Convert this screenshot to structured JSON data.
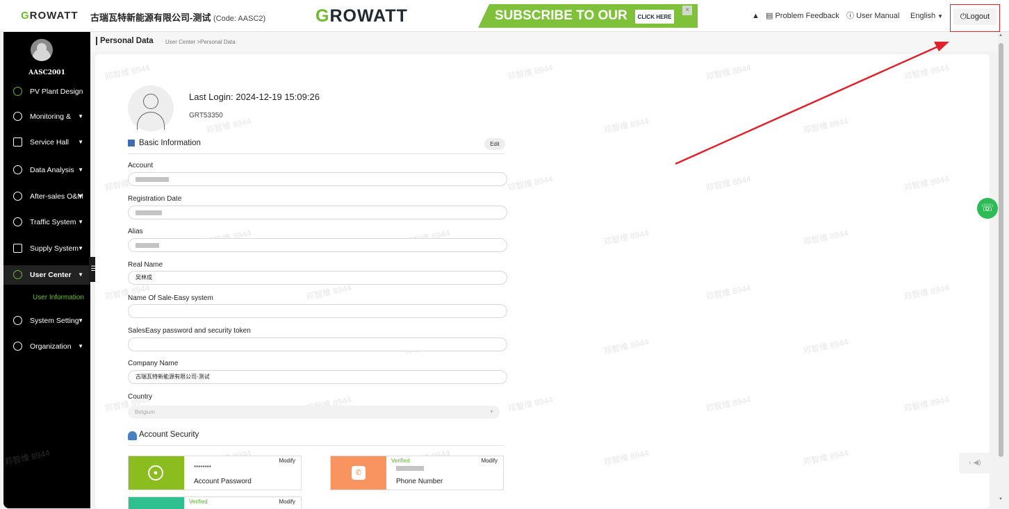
{
  "header": {
    "logo_text": "ROWATT",
    "logo_initial": "G",
    "company_name": "古瑞瓦特新能源有限公司-测试",
    "company_code": "(Code: AASC2)",
    "banner": {
      "brand_initial": "G",
      "brand_rest": "ROWATT",
      "text": "SUBSCRIBE TO OUR NEWSLETTER",
      "cta": "CLICK HERE"
    },
    "bell_icon": "bell-icon",
    "problem_feedback": "Problem Feedback",
    "user_manual": "User Manual",
    "language": "English",
    "logout": "Logout"
  },
  "sidebar": {
    "username": "AASC2001",
    "items": [
      {
        "label": "PV Plant Design",
        "icon": "pv-design-icon"
      },
      {
        "label": "Monitoring &",
        "icon": "monitoring-icon"
      },
      {
        "label": "Service Hall",
        "icon": "service-hall-icon"
      },
      {
        "label": "Data Analysis",
        "icon": "data-analysis-icon"
      },
      {
        "label": "After-sales O&M",
        "icon": "after-sales-icon"
      },
      {
        "label": "Traffic System",
        "icon": "traffic-icon"
      },
      {
        "label": "Supply System",
        "icon": "supply-icon"
      },
      {
        "label": "User Center",
        "icon": "user-center-icon"
      },
      {
        "label": "System Setting",
        "icon": "system-setting-icon"
      },
      {
        "label": "Organization",
        "icon": "organization-icon"
      }
    ],
    "active_sub": "User Information"
  },
  "page": {
    "title": "Personal Data",
    "breadcrumb": "User Center >Personal Data",
    "last_login": "Last Login: 2024-12-19 15:09:26",
    "user_code": "GRT53350"
  },
  "basic_info": {
    "heading": "Basic Information",
    "edit": "Edit",
    "fields": {
      "account_label": "Account",
      "registration_label": "Registration Date",
      "alias_label": "Alias",
      "real_name_label": "Real Name",
      "real_name_value": "吴林成",
      "sale_easy_label": "Name Of Sale-Easy system",
      "sale_easy_value": "",
      "token_label": "SalesEasy password and security token",
      "token_value": "",
      "company_label": "Company Name",
      "company_value": "古瑞瓦特新能源有限公司-测试",
      "country_label": "Country",
      "country_value": "Belgium"
    }
  },
  "account_security": {
    "heading": "Account Security",
    "cards": [
      {
        "name": "Account Password",
        "value": "********",
        "modify": "Modify",
        "verified": "",
        "color": "#8cbd1e"
      },
      {
        "name": "Phone Number",
        "value": "",
        "modify": "Modify",
        "verified": "Verified",
        "color": "#f99461"
      },
      {
        "name": "",
        "value": "",
        "modify": "Modify",
        "verified": "Verified",
        "color": "#2ec08e"
      }
    ]
  },
  "watermark": "邓智维 8944",
  "colors": {
    "brand_green": "#6fba2c",
    "annotation_red": "#e0212b",
    "sidebar_bg": "#000000"
  }
}
